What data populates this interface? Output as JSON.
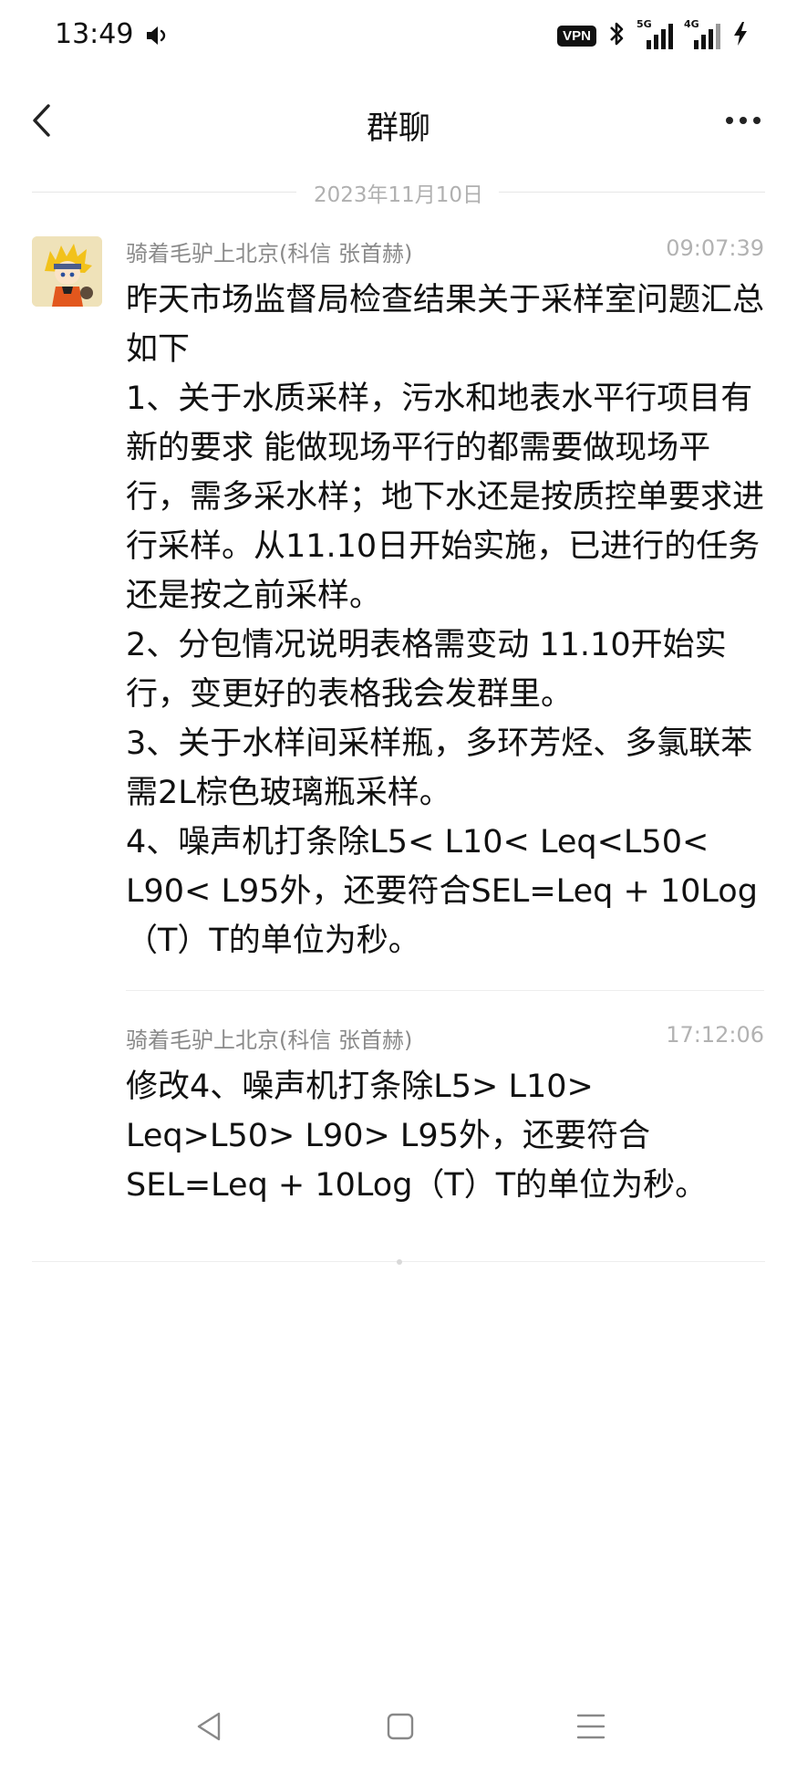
{
  "status_bar": {
    "time": "13:49",
    "vpn_label": "VPN",
    "signal1_label": "5G",
    "signal2_label": "4G",
    "icons": [
      "volume-icon",
      "bluetooth-icon",
      "signal-5g-icon",
      "signal-4g-icon",
      "charging-bolt-icon"
    ]
  },
  "header": {
    "title": "群聊",
    "back_icon": "chevron-left-icon",
    "more_icon": "more-dots-icon"
  },
  "date_separator": "2023年11月10日",
  "messages": [
    {
      "sender": "骑着毛驴上北京(科信 张首赫)",
      "time": "09:07:39",
      "text": "昨天市场监督局检查结果关于采样室问题汇总如下\n1、关于水质采样，污水和地表水平行项目有新的要求 能做现场平行的都需要做现场平行，需多采水样；地下水还是按质控单要求进行采样。从11.10日开始实施，已进行的任务还是按之前采样。\n2、分包情况说明表格需变动 11.10开始实行，变更好的表格我会发群里。\n3、关于水样间采样瓶，多环芳烃、多氯联苯需2L棕色玻璃瓶采样。\n4、噪声机打条除L5< L10< Leq<L50< L90< L95外，还要符合SEL=Leq + 10Log（T）T的单位为秒。"
    },
    {
      "sender": "骑着毛驴上北京(科信 张首赫)",
      "time": "17:12:06",
      "text": "修改4、噪声机打条除L5> L10> Leq>L50> L90> L95外，还要符合SEL=Leq + 10Log（T）T的单位为秒。"
    }
  ],
  "nav_bar": {
    "icons": [
      "back-triangle-icon",
      "home-square-icon",
      "menu-lines-icon"
    ]
  }
}
